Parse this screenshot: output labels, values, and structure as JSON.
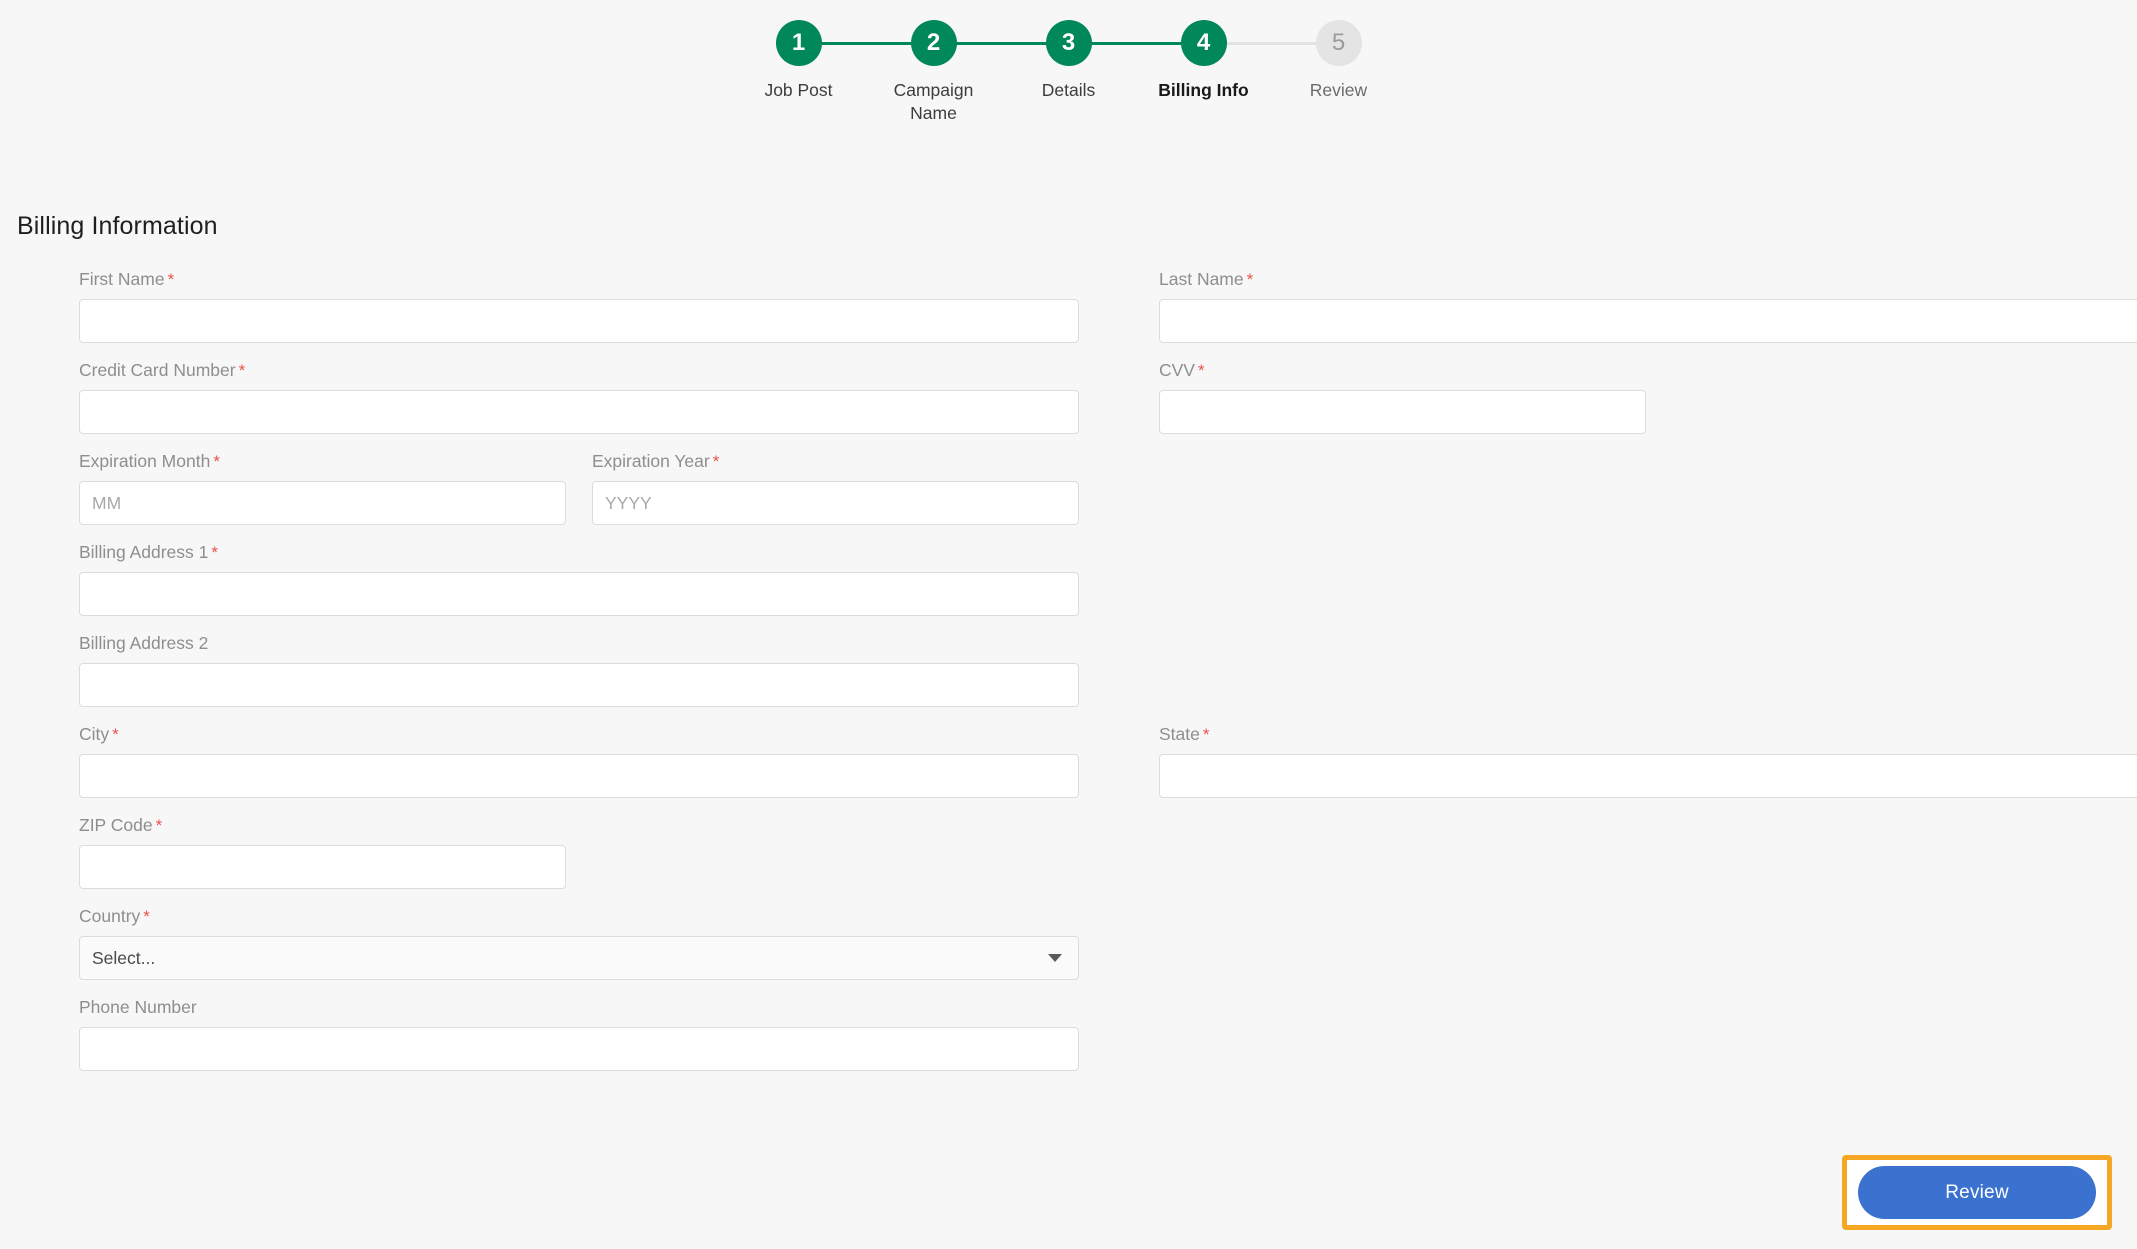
{
  "stepper": {
    "steps": [
      {
        "number": "1",
        "label": "Job Post",
        "state": "complete"
      },
      {
        "number": "2",
        "label": "Campaign Name",
        "state": "complete"
      },
      {
        "number": "3",
        "label": "Details",
        "state": "complete"
      },
      {
        "number": "4",
        "label": "Billing Info",
        "state": "current"
      },
      {
        "number": "5",
        "label": "Review",
        "state": "inactive"
      }
    ],
    "colors": {
      "complete": "#00875a",
      "inactive_circle": "#e4e4e4",
      "inactive_text": "#9b9b9b",
      "connector_done": "#00875a",
      "connector_pending": "#e2e2e2"
    }
  },
  "section": {
    "title": "Billing Information"
  },
  "fields": {
    "first_name": {
      "label": "First Name",
      "required_mark": "*",
      "value": "",
      "placeholder": ""
    },
    "last_name": {
      "label": "Last Name",
      "required_mark": "*",
      "value": "",
      "placeholder": ""
    },
    "credit_card": {
      "label": "Credit Card Number",
      "required_mark": "*",
      "value": "",
      "placeholder": ""
    },
    "cvv": {
      "label": "CVV",
      "required_mark": "*",
      "value": "",
      "placeholder": ""
    },
    "exp_month": {
      "label": "Expiration Month",
      "required_mark": "*",
      "value": "",
      "placeholder": "MM"
    },
    "exp_year": {
      "label": "Expiration Year",
      "required_mark": "*",
      "value": "",
      "placeholder": "YYYY"
    },
    "billing_address1": {
      "label": "Billing Address 1",
      "required_mark": "*",
      "value": "",
      "placeholder": ""
    },
    "billing_address2": {
      "label": "Billing Address 2",
      "required_mark": "",
      "value": "",
      "placeholder": ""
    },
    "city": {
      "label": "City",
      "required_mark": "*",
      "value": "",
      "placeholder": ""
    },
    "state": {
      "label": "State",
      "required_mark": "*",
      "value": "",
      "placeholder": ""
    },
    "zip": {
      "label": "ZIP Code",
      "required_mark": "*",
      "value": "",
      "placeholder": ""
    },
    "country": {
      "label": "Country",
      "required_mark": "*",
      "selected": "Select..."
    },
    "phone": {
      "label": "Phone Number",
      "required_mark": "",
      "value": "",
      "placeholder": ""
    }
  },
  "footer": {
    "review_label": "Review",
    "review_color": "#3b72d0",
    "highlight_color": "#f5a623"
  }
}
